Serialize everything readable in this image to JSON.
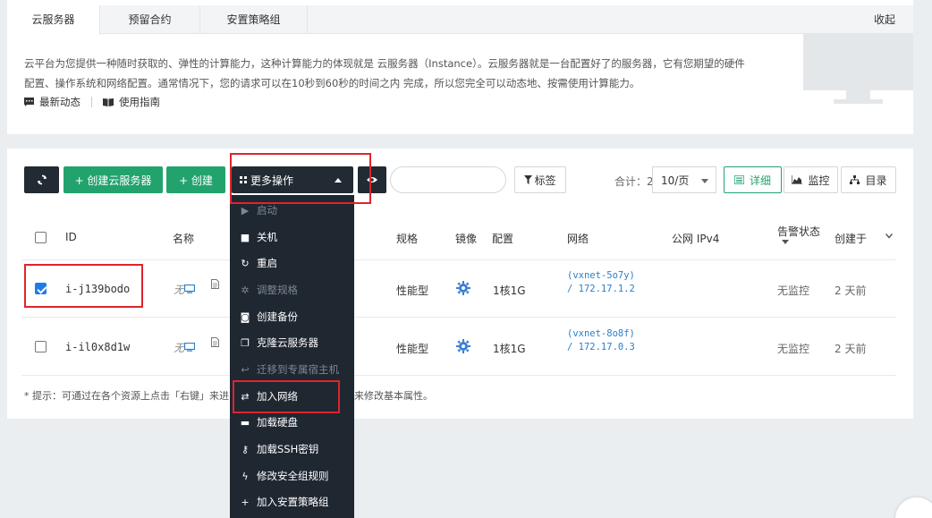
{
  "tabs": [
    "云服务器",
    "预留合约",
    "安置策略组"
  ],
  "collapse_label": "收起",
  "intro_text": "云平台为您提供一种随时获取的、弹性的计算能力，这种计算能力的体现就是 云服务器（Instance）。云服务器就是一台配置好了的服务器，它有您期望的硬件配置、操作系统和网络配置。通常情况下，您的请求可以在10秒到60秒的时间之内 完成，所以您完全可以动态地、按需使用计算能力。",
  "links": {
    "news": "最新动态",
    "guide": "使用指南"
  },
  "toolbar": {
    "create_instance": "+ 创建云服务器",
    "create": "+ 创建",
    "more_actions": "更多操作",
    "tags": "标签",
    "total": "合计：2",
    "page_size": "10/页",
    "detail": "详细",
    "monitor": "监控",
    "catalog": "目录"
  },
  "table": {
    "headers": {
      "id": "ID",
      "name": "名称",
      "spec": "规格",
      "image": "镜像",
      "config": "配置",
      "network": "网络",
      "public_ip": "公网 IPv4",
      "alarm": "告警状态",
      "created": "创建于"
    },
    "rows": [
      {
        "id": "i-j139bodo",
        "name_placeholder": "无",
        "spec": "性能型",
        "config": "1核1G",
        "net_line1": "(vxnet-5o7y)",
        "net_line2": "/ 172.17.1.2",
        "alarm": "无监控",
        "created": "2 天前",
        "checked": true
      },
      {
        "id": "i-il0x8d1w",
        "name_placeholder": "无",
        "spec": "性能型",
        "config": "1核1G",
        "net_line1": "(vxnet-8o8f)",
        "net_line2": "/ 172.17.0.3",
        "alarm": "无监控",
        "created": "2 天前",
        "checked": false
      }
    ]
  },
  "hint_prefix": "* 提示：可通过在各个资源上点击「右键」来进",
  "hint_suffix": "来修改基本属性。",
  "dropdown": [
    {
      "label": "启动",
      "icon": "play-icon",
      "disabled": true
    },
    {
      "label": "关机",
      "icon": "stop-icon",
      "disabled": false
    },
    {
      "label": "重启",
      "icon": "restart-icon",
      "disabled": false
    },
    {
      "label": "调整规格",
      "icon": "gear-icon",
      "disabled": true
    },
    {
      "label": "创建备份",
      "icon": "camera-icon",
      "disabled": false
    },
    {
      "label": "克隆云服务器",
      "icon": "clone-icon",
      "disabled": false
    },
    {
      "label": "迁移到专属宿主机",
      "icon": "reply-icon",
      "disabled": true
    },
    {
      "label": "加入网络",
      "icon": "network-join-icon",
      "disabled": false
    },
    {
      "label": "加载硬盘",
      "icon": "disk-icon",
      "disabled": false
    },
    {
      "label": "加载SSH密钥",
      "icon": "key-icon",
      "disabled": false
    },
    {
      "label": "修改安全组规则",
      "icon": "bolt-icon",
      "disabled": false
    },
    {
      "label": "加入安置策略组",
      "icon": "plus-icon",
      "disabled": false
    }
  ],
  "colors": {
    "green": "#22a36e",
    "dark": "#222b33",
    "link": "#2b7fc8",
    "highlight": "#e0242c"
  }
}
